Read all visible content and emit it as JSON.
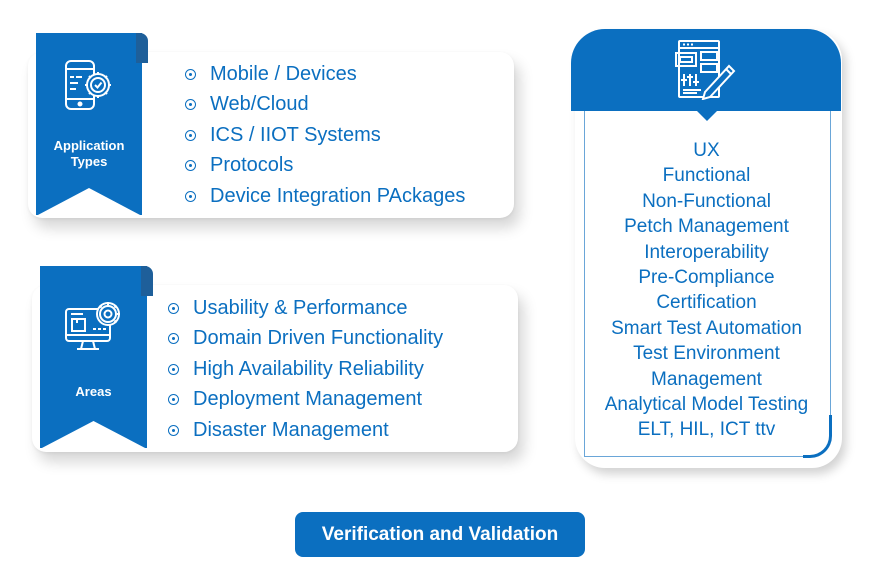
{
  "application_types": {
    "title_line1": "Application",
    "title_line2": "Types",
    "icon": "mobile-gear-icon",
    "items": [
      "Mobile / Devices",
      "Web/Cloud",
      "ICS / IIOT Systems",
      "Protocols",
      "Device Integration PAckages"
    ]
  },
  "areas": {
    "title": "Areas",
    "icon": "monitor-gear-icon",
    "items": [
      "Usability & Performance",
      "Domain Driven Functionality",
      "High Availability Reliability",
      "Deployment Management",
      "Disaster Management"
    ]
  },
  "testing_types": {
    "icon": "design-tools-icon",
    "items": [
      "UX",
      "Functional",
      "Non-Functional",
      "Petch Management",
      "Interoperability",
      "Pre-Compliance",
      "Certification",
      "Smart Test Automation",
      "Test Environment",
      "Management",
      "Analytical Model Testing",
      "ELT, HIL, ICT ttv"
    ]
  },
  "footer": {
    "label": "Verification and Validation"
  },
  "colors": {
    "accent": "#0b6fc0",
    "ribbon_fold": "#1e5f9a",
    "background": "#ffffff"
  }
}
